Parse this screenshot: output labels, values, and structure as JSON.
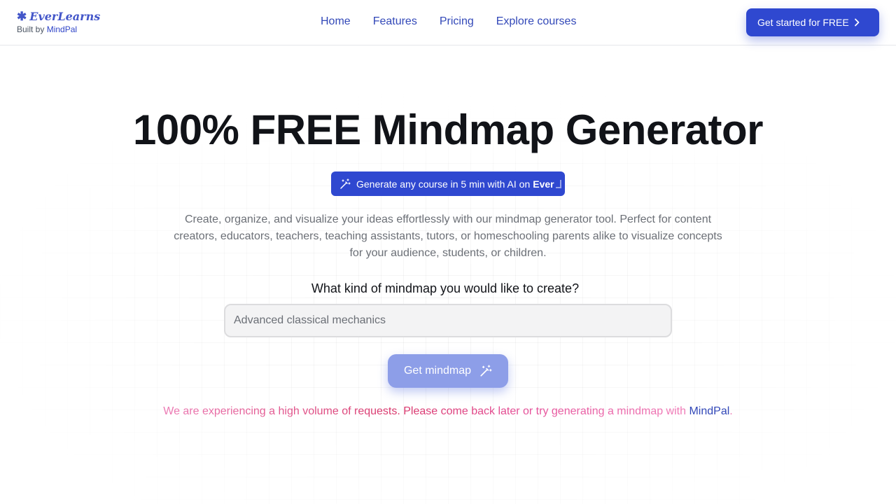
{
  "header": {
    "brand_name": "EverLearns",
    "built_by_prefix": "Built by",
    "built_by_link": "MindPal",
    "nav": [
      "Home",
      "Features",
      "Pricing",
      "Explore courses"
    ],
    "cta_label": "Get started for FREE"
  },
  "main": {
    "title": "100% FREE Mindmap Generator",
    "promo_text": "Generate any course in 5 min with AI on",
    "promo_brand_partial": "Ever",
    "description": "Create, organize, and visualize your ideas effortlessly with our mindmap generator tool. Perfect for content creators, educators, teachers, teaching assistants, tutors, or homeschooling parents alike to visualize concepts for your audience, students, or children.",
    "question": "What kind of mindmap you would like to create?",
    "input_placeholder": "Advanced classical mechanics",
    "generate_button": "Get mindmap",
    "notice_text": "We are experiencing a high volume of requests. Please come back later or try generating a mindmap with",
    "notice_link": "MindPal",
    "notice_end": "."
  },
  "colors": {
    "primary": "#2f48d0",
    "button_disabled": "#8d9ee8",
    "error_pink": "#d9366b"
  },
  "icons": [
    "star-logo-icon",
    "chevron-right-icon",
    "magic-wand-icon"
  ]
}
